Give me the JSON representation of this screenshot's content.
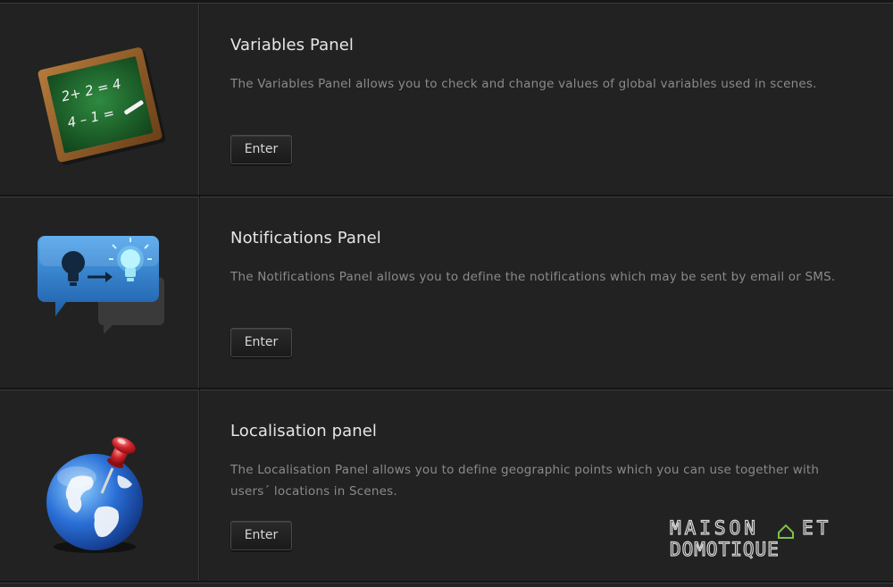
{
  "panels": [
    {
      "title": "Variables Panel",
      "description": "The Variables Panel allows you to check and change values of global variables used in scenes.",
      "button_label": "Enter",
      "icon": "chalkboard-icon",
      "chalk_lines": [
        "2+ 2 = 4",
        "4 – 1 ="
      ]
    },
    {
      "title": "Notifications Panel",
      "description": "The Notifications Panel allows you to define the notifications which may be sent by email or SMS.",
      "button_label": "Enter",
      "icon": "notification-lightbulb-icon"
    },
    {
      "title": "Localisation panel",
      "description": "The Localisation Panel allows you to define geographic points which you can use together with users´ locations in Scenes.",
      "button_label": "Enter",
      "icon": "globe-pin-icon"
    }
  ],
  "watermark": {
    "line1": "MAISON",
    "line1b": "ET",
    "line2": "DOMOTIQUE"
  },
  "colors": {
    "background": "#222222",
    "title": "#e6e6e6",
    "description": "#8a8a8a",
    "chalkboard": "#1f6b2e",
    "frame": "#8a5a2b",
    "bubble_blue": "#2e7fd0",
    "globe_blue": "#2a6fd6",
    "pin_red": "#d0242a",
    "watermark_green": "#7cc04a"
  }
}
